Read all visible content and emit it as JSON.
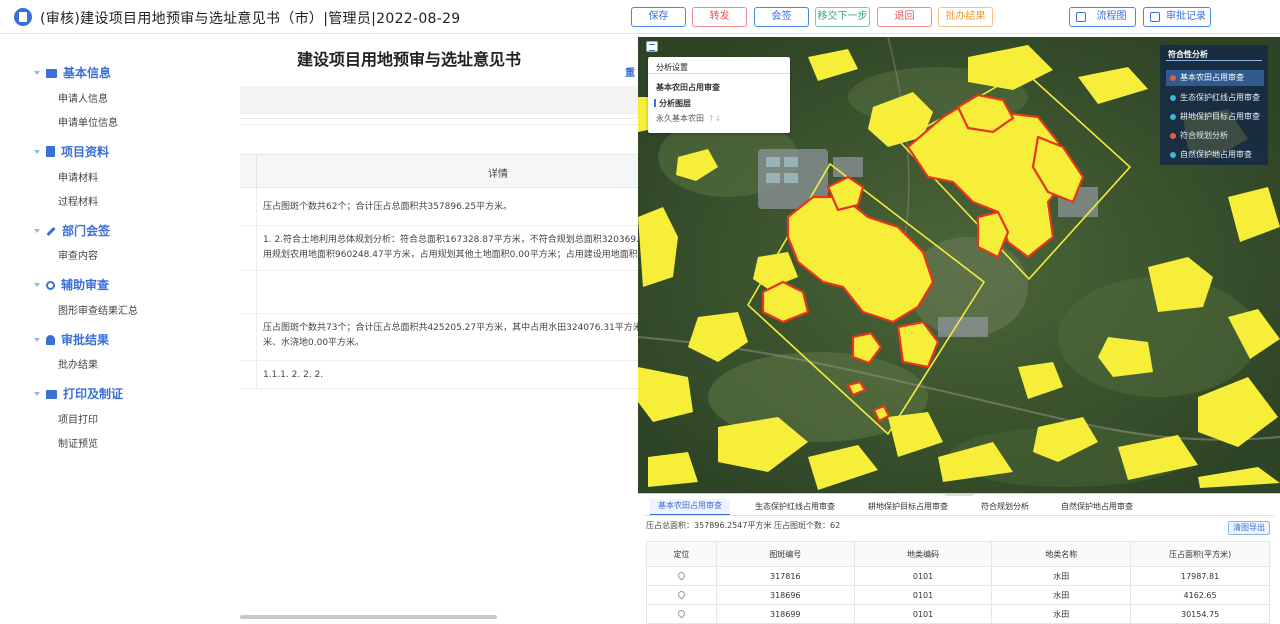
{
  "header": {
    "title": "(审核)建设项目用地预审与选址意见书（市）|管理员|2022-08-29",
    "buttons": [
      "保存",
      "转发",
      "会签",
      "移交下一步",
      "退回",
      "批办结果"
    ],
    "flow_label": "流程图",
    "record_label": "审批记录"
  },
  "sidebar": {
    "sections": [
      {
        "title": "基本信息",
        "items": [
          "申请人信息",
          "申请单位信息"
        ]
      },
      {
        "title": "项目资料",
        "items": [
          "申请材料",
          "过程材料"
        ]
      },
      {
        "title": "部门会签",
        "items": [
          "审查内容"
        ]
      },
      {
        "title": "辅助审查",
        "items": [
          "图形审查结果汇总"
        ]
      },
      {
        "title": "审批结果",
        "items": [
          "批办结果"
        ]
      },
      {
        "title": "打印及制证",
        "items": [
          "项目打印",
          "制证预览"
        ]
      }
    ]
  },
  "main": {
    "doc_title": "建设项目用地预审与选址意见书",
    "doc_link": "重",
    "column_header": "详情",
    "rows": [
      [
        "压占图斑个数共62个；合计压占总面积共357896.25平方米。"
      ],
      [
        "1. 2.符合土地利用总体规划分析：符合总面积167328.87平方米，不符合规划总面积320369.",
        "用规划农用地面积960248.47平方米，占用规划其他土地面积0.00平方米；占用建设用地面积"
      ],
      [],
      [
        "压占图斑个数共73个；合计压占总面积共425205.27平方米，其中占用水田324076.31平方米",
        "米、水浇地0.00平方米。"
      ],
      [
        "1.1.1. 2. 2. 2."
      ]
    ]
  },
  "map": {
    "analysis_panel": {
      "title": "分析设置",
      "item1": "基本农田占用审查",
      "item2": "分析图层",
      "item3": "永久基本农田",
      "sort_glyph": "↑↓"
    },
    "fit_panel": {
      "title": "符合性分析",
      "items": [
        {
          "label": "基本农田占用审查",
          "color": "#e25b4a",
          "active": true
        },
        {
          "label": "生态保护红线占用审查",
          "color": "#3fb5e0",
          "active": false
        },
        {
          "label": "耕地保护目标占用审查",
          "color": "#3fb5e0",
          "active": false
        },
        {
          "label": "符合规划分析",
          "color": "#e25b4a",
          "active": false
        },
        {
          "label": "自然保护地占用审查",
          "color": "#3fb5e0",
          "active": false
        }
      ]
    }
  },
  "table_panel": {
    "tabs": [
      "基本农田占用审查",
      "生态保护红线占用审查",
      "耕地保护目标占用审查",
      "符合规划分析",
      "自然保护地占用审查"
    ],
    "summary": "压占总面积：357896.2547平方米 压占图斑个数：62",
    "export_label": "清图导出",
    "columns": [
      "定位",
      "图斑编号",
      "地类编码",
      "地类名称",
      "压占面积(平方米)"
    ],
    "rows": [
      [
        "317816",
        "0101",
        "水田",
        "17987.81"
      ],
      [
        "318696",
        "0101",
        "水田",
        "4162.65"
      ],
      [
        "318699",
        "0101",
        "水田",
        "30154.75"
      ]
    ]
  },
  "colors": {
    "accent": "#3b6fd8",
    "farmland_yellow": "#f7ee3a",
    "overlap_red": "#e2361f",
    "boundary": "#f3ec3c"
  }
}
